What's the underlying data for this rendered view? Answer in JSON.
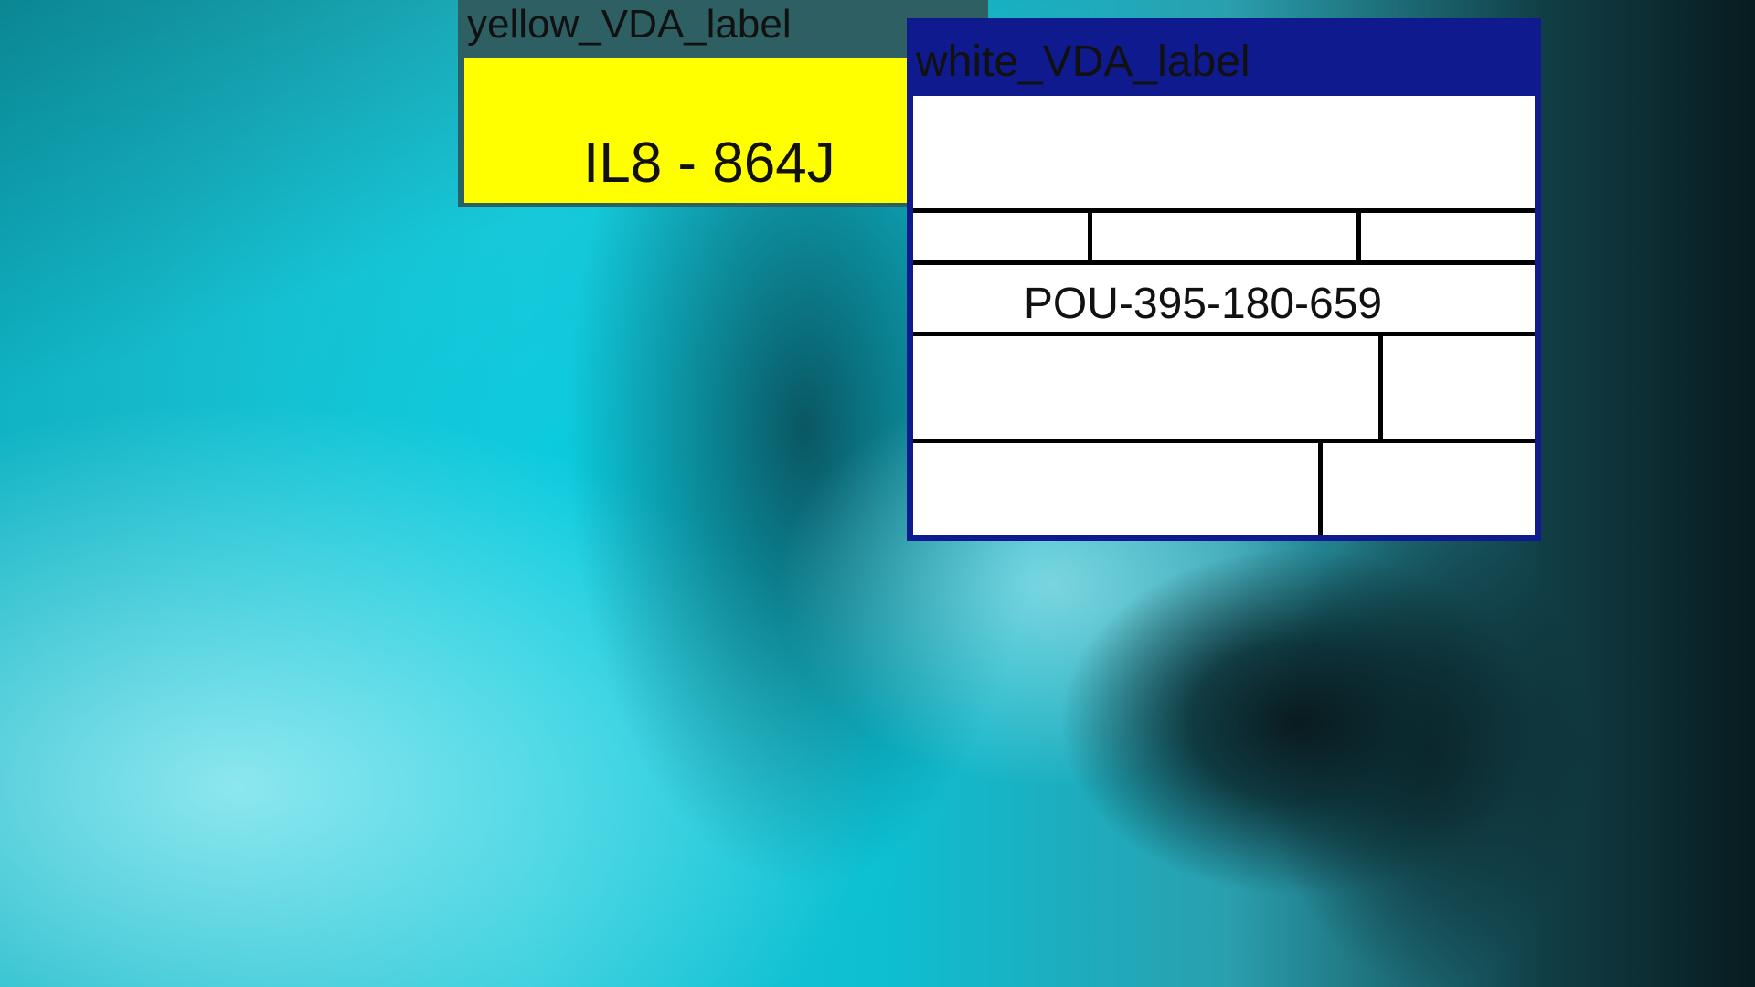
{
  "desktop": {
    "wallpaper": "teal-abstract-fluid"
  },
  "windows": {
    "yellow": {
      "title": "yellow_VDA_label",
      "code": "IL8 - 864J",
      "background_color": "#ffff00",
      "titlebar_color": "#2e5f62"
    },
    "white": {
      "title": "white_VDA_label",
      "number": "POU-395-180-659",
      "background_color": "#ffffff",
      "titlebar_color": "#0f1a8f"
    }
  }
}
